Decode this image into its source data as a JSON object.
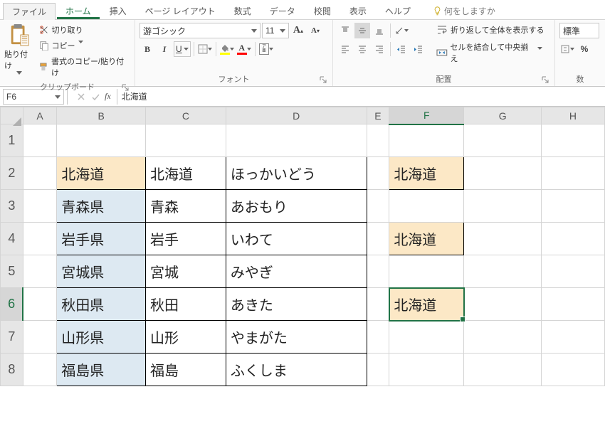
{
  "tabs": {
    "file": "ファイル",
    "home": "ホーム",
    "insert": "挿入",
    "pagelayout": "ページ レイアウト",
    "formulas": "数式",
    "data": "データ",
    "review": "校閲",
    "view": "表示",
    "help": "ヘルプ",
    "tellme": "何をしますか"
  },
  "clipboard": {
    "paste": "貼り付け",
    "cut": "切り取り",
    "copy": "コピー",
    "format_painter": "書式のコピー/貼り付け",
    "group_label": "クリップボード"
  },
  "font": {
    "name": "游ゴシック",
    "size": "11",
    "ruby_top": "ア",
    "ruby_bot": "亜",
    "group_label": "フォント",
    "fill_color": "#ffff00",
    "font_color": "#ff0000"
  },
  "B": "B",
  "I": "I",
  "U": "U",
  "A": "A",
  "align": {
    "wrap": "折り返して全体を表示する",
    "merge": "セルを結合して中央揃え",
    "group_label": "配置"
  },
  "number": {
    "format": "標準",
    "group_label": "数",
    "percent": "%"
  },
  "fbar": {
    "namebox": "F6",
    "fx": "fx",
    "formula": "北海道"
  },
  "cols": {
    "a": "A",
    "b": "B",
    "c": "C",
    "d": "D",
    "e": "E",
    "f": "F",
    "g": "G",
    "h": "H"
  },
  "rows": [
    "1",
    "2",
    "3",
    "4",
    "5",
    "6",
    "7",
    "8"
  ],
  "cells": {
    "b2": "北海道",
    "c2": "北海道",
    "d2": "ほっかいどう",
    "f2": "北海道",
    "b3": "青森県",
    "c3": "青森",
    "d3": "あおもり",
    "b4": "岩手県",
    "c4": "岩手",
    "d4": "いわて",
    "f4": "北海道",
    "b5": "宮城県",
    "c5": "宮城",
    "d5": "みやぎ",
    "b6": "秋田県",
    "c6": "秋田",
    "d6": "あきた",
    "f6": "北海道",
    "b7": "山形県",
    "c7": "山形",
    "d7": "やまがた",
    "b8": "福島県",
    "c8": "福島",
    "d8": "ふくしま"
  }
}
